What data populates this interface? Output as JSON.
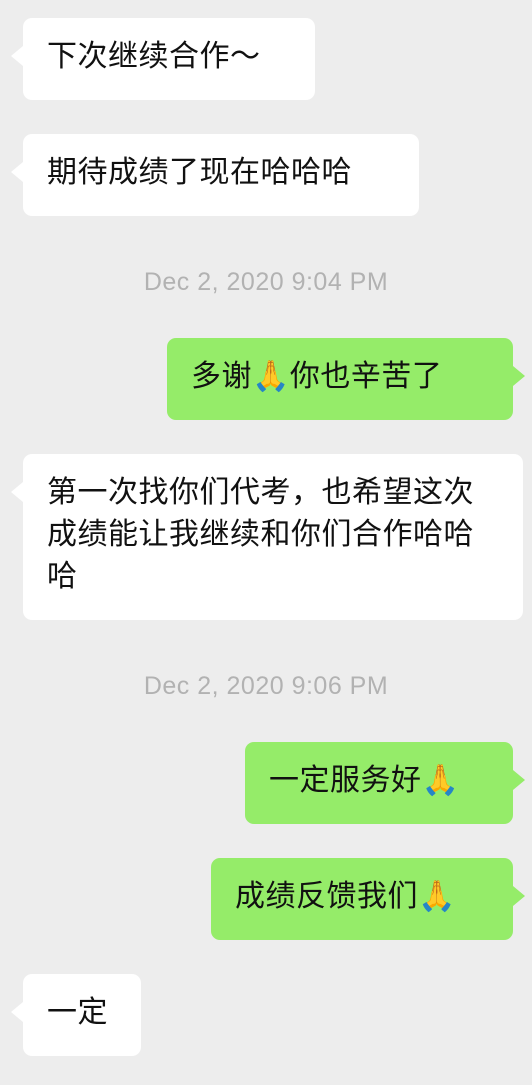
{
  "conversation": {
    "messages": [
      {
        "side": "left",
        "text": "下次继续合作～"
      },
      {
        "side": "left",
        "text": "期待成绩了现在哈哈哈"
      },
      {
        "side": "right",
        "text": "多谢🙏你也辛苦了"
      },
      {
        "side": "left",
        "text": "第一次找你们代考，也希望这次成绩能让我继续和你们合作哈哈哈"
      },
      {
        "side": "right",
        "text": "一定服务好🙏"
      },
      {
        "side": "right",
        "text": "成绩反馈我们🙏"
      },
      {
        "side": "left",
        "text": "一定"
      }
    ],
    "timestamps": [
      "Dec 2, 2020 9:04 PM",
      "Dec 2, 2020 9:06 PM"
    ]
  },
  "colors": {
    "background": "#ededed",
    "incoming_bubble": "#ffffff",
    "outgoing_bubble": "#95ec69",
    "timestamp_text": "#b2b2b2"
  }
}
